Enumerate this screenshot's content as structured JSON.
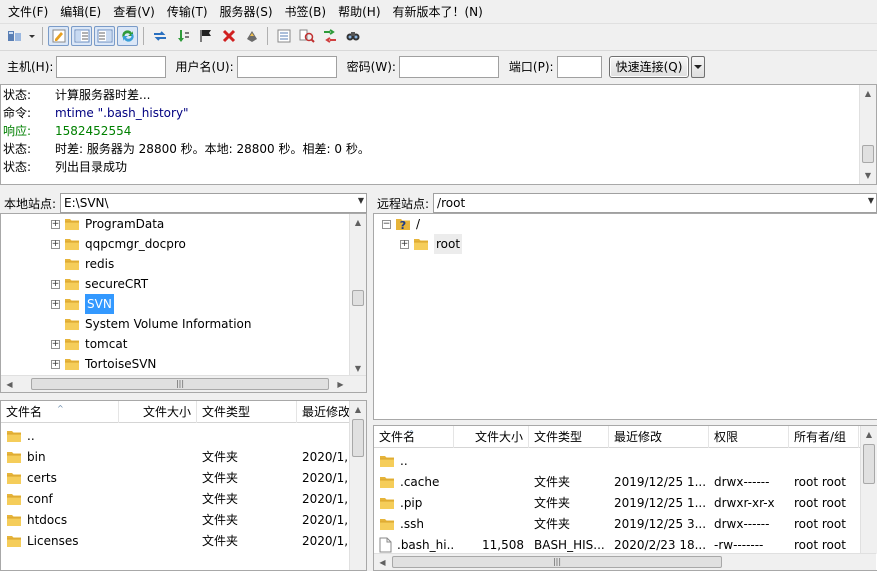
{
  "menu": [
    "文件(F)",
    "编辑(E)",
    "查看(V)",
    "传输(T)",
    "服务器(S)",
    "书签(B)",
    "帮助(H)",
    "有新版本了！(N)"
  ],
  "quickconnect": {
    "host_label": "主机(H):",
    "user_label": "用户名(U):",
    "pass_label": "密码(W):",
    "port_label": "端口(P):",
    "host_value": "",
    "user_value": "",
    "pass_value": "",
    "port_value": "",
    "connect_label": "快速连接(Q)"
  },
  "log": [
    {
      "type": "状态:",
      "msg": "计算服务器时差...",
      "kind": "status"
    },
    {
      "type": "命令:",
      "msg": "mtime \".bash_history\"",
      "kind": "cmd"
    },
    {
      "type": "响应:",
      "msg": "1582452554",
      "kind": "resp"
    },
    {
      "type": "状态:",
      "msg": "时差: 服务器为 28800 秒。本地: 28800 秒。相差: 0 秒。",
      "kind": "status"
    },
    {
      "type": "状态:",
      "msg": "列出目录成功",
      "kind": "status"
    }
  ],
  "local": {
    "site_label": "本地站点:",
    "path": "E:\\SVN\\",
    "tree": [
      {
        "name": "ProgramData",
        "expandable": true,
        "selected": false
      },
      {
        "name": "qqpcmgr_docpro",
        "expandable": true,
        "selected": false
      },
      {
        "name": "redis",
        "expandable": false,
        "selected": false
      },
      {
        "name": "secureCRT",
        "expandable": true,
        "selected": false
      },
      {
        "name": "SVN",
        "expandable": true,
        "selected": true
      },
      {
        "name": "System Volume Information",
        "expandable": false,
        "selected": false
      },
      {
        "name": "tomcat",
        "expandable": true,
        "selected": false
      },
      {
        "name": "TortoiseSVN",
        "expandable": true,
        "selected": false
      }
    ],
    "columns": [
      "文件名",
      "文件大小",
      "文件类型",
      "最近修改"
    ],
    "files": [
      {
        "name": "..",
        "size": "",
        "type": "",
        "modified": ""
      },
      {
        "name": "bin",
        "size": "",
        "type": "文件夹",
        "modified": "2020/1,"
      },
      {
        "name": "certs",
        "size": "",
        "type": "文件夹",
        "modified": "2020/1,"
      },
      {
        "name": "conf",
        "size": "",
        "type": "文件夹",
        "modified": "2020/1,"
      },
      {
        "name": "htdocs",
        "size": "",
        "type": "文件夹",
        "modified": "2020/1,"
      },
      {
        "name": "Licenses",
        "size": "",
        "type": "文件夹",
        "modified": "2020/1,"
      }
    ]
  },
  "remote": {
    "site_label": "远程站点:",
    "path": "/root",
    "tree": [
      {
        "name": "/",
        "expandable": false,
        "unknown": true
      },
      {
        "name": "root",
        "expandable": true,
        "unknown": false
      }
    ],
    "columns": [
      "文件名",
      "文件大小",
      "文件类型",
      "最近修改",
      "权限",
      "所有者/组"
    ],
    "files": [
      {
        "name": "..",
        "size": "",
        "type": "",
        "modified": "",
        "perm": "",
        "owner": "",
        "kind": "folder"
      },
      {
        "name": ".cache",
        "size": "",
        "type": "文件夹",
        "modified": "2019/12/25 1...",
        "perm": "drwx------",
        "owner": "root root",
        "kind": "folder"
      },
      {
        "name": ".pip",
        "size": "",
        "type": "文件夹",
        "modified": "2019/12/25 1...",
        "perm": "drwxr-xr-x",
        "owner": "root root",
        "kind": "folder"
      },
      {
        "name": ".ssh",
        "size": "",
        "type": "文件夹",
        "modified": "2019/12/25 3...",
        "perm": "drwx------",
        "owner": "root root",
        "kind": "folder"
      },
      {
        "name": ".bash_hi...",
        "size": "11,508",
        "type": "BASH_HIS...",
        "modified": "2020/2/23 18...",
        "perm": "-rw-------",
        "owner": "root root",
        "kind": "file"
      }
    ]
  }
}
